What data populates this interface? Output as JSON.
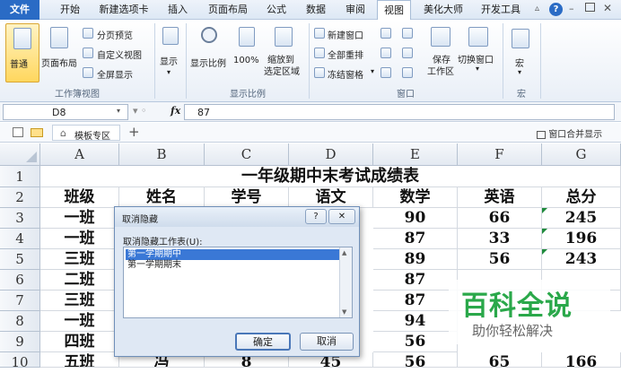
{
  "menu": {
    "tabs": [
      {
        "label": "文件"
      },
      {
        "label": "开始"
      },
      {
        "label": "新建选项卡"
      },
      {
        "label": "插入"
      },
      {
        "label": "页面布局"
      },
      {
        "label": "公式"
      },
      {
        "label": "数据"
      },
      {
        "label": "审阅"
      },
      {
        "label": "视图"
      },
      {
        "label": "美化大师"
      },
      {
        "label": "开发工具"
      }
    ]
  },
  "ribbon": {
    "normal": "普通",
    "page_layout": "页面布局",
    "page_break_preview": "分页预览",
    "custom_view": "自定义视图",
    "full_screen": "全屏显示",
    "group_workbook_views": "工作簿视图",
    "show": "显示",
    "zoom": "显示比例",
    "zoom_100": "100%",
    "zoom_to_selection_1": "缩放到",
    "zoom_to_selection_2": "选定区域",
    "group_zoom": "显示比例",
    "new_window": "新建窗口",
    "arrange_all": "全部重排",
    "freeze_panes": "冻结窗格",
    "save_workspace_1": "保存",
    "save_workspace_2": "工作区",
    "switch_windows": "切换窗口",
    "group_window": "窗口",
    "macros": "宏",
    "group_macros": "宏"
  },
  "formula_bar": {
    "name_box": "D8",
    "fx": "fx",
    "value": "87"
  },
  "tabstrip": {
    "template_zone": "模板专区",
    "add": "+",
    "merge_windows": "窗口合并显示"
  },
  "sheet": {
    "columns": [
      "A",
      "B",
      "C",
      "D",
      "E",
      "F",
      "G"
    ],
    "rows": [
      "1",
      "2",
      "3",
      "4",
      "5",
      "6",
      "7",
      "8",
      "9",
      "10"
    ],
    "title": "一年级期中末考试成绩表",
    "headers": [
      "班级",
      "姓名",
      "学号",
      "语文",
      "数学",
      "英语",
      "总分"
    ],
    "data": [
      [
        "一班",
        "",
        "",
        "",
        "90",
        "66",
        "245"
      ],
      [
        "一班",
        "",
        "",
        "",
        "87",
        "33",
        "196"
      ],
      [
        "三班",
        "",
        "",
        "",
        "89",
        "56",
        "243"
      ],
      [
        "二班",
        "",
        "",
        "",
        "87",
        "",
        ""
      ],
      [
        "三班",
        "",
        "",
        "",
        "87",
        "",
        ""
      ],
      [
        "一班",
        "",
        "",
        "",
        "94",
        "",
        ""
      ],
      [
        "四班",
        "",
        "",
        "",
        "56",
        "",
        ""
      ],
      [
        "五班",
        "冯",
        "8",
        "45",
        "56",
        "65",
        "166"
      ]
    ]
  },
  "dialog": {
    "title": "取消隐藏",
    "help": "?",
    "close": "✕",
    "list_label": "取消隐藏工作表(U):",
    "items": [
      "第一学期期中",
      "第一学期期末"
    ],
    "ok": "确定",
    "cancel": "取消"
  },
  "watermark": {
    "brand": "百科全说",
    "slogan": "助你轻松解决"
  },
  "colors": {
    "accent": "#2a6bc5",
    "selection": "#3a78d6",
    "watermark_green": "#2aa84a"
  }
}
